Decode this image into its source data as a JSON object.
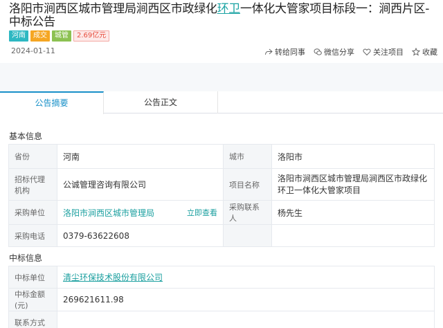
{
  "title": {
    "part1": "洛阳市涧西区城市管理局涧西区市政绿化",
    "highlight": "环卫",
    "part2": "一体化大管家项目标段一：涧西片区-中标公告"
  },
  "tags": [
    "河南",
    "成交",
    "城管",
    "2.69亿元"
  ],
  "date": "2024-01-11",
  "actions": {
    "forward": "转给同事",
    "wechat": "微信分享",
    "follow": "关注项目",
    "favorite": "收藏"
  },
  "tabs": [
    "公告摘要",
    "公告正文"
  ],
  "basic": {
    "title": "基本信息",
    "province_label": "省份",
    "province": "河南",
    "city_label": "城市",
    "city": "洛阳市",
    "agency_label": "招标代理机构",
    "agency": "公诚管理咨询有限公司",
    "project_label": "项目名称",
    "project": "洛阳市涧西区城市管理局涧西区市政绿化环卫一体化大管家项目",
    "buyer_label": "采购单位",
    "buyer": "洛阳市涧西区城市管理局",
    "check_now": "立即查看",
    "contact_label": "采购联系人",
    "contact": "杨先生",
    "phone_label": "采购电话",
    "phone": "0379-63622608"
  },
  "winner": {
    "title": "中标信息",
    "unit_label": "中标单位",
    "unit": "清尘环保技术股份有限公司",
    "amount_label": "中标金额(元)",
    "amount": "269621611.98",
    "contact_label": "联系方式",
    "contact": ""
  },
  "colors": {
    "accent": "#1a9f9f",
    "tab_active": "#1890c8"
  }
}
